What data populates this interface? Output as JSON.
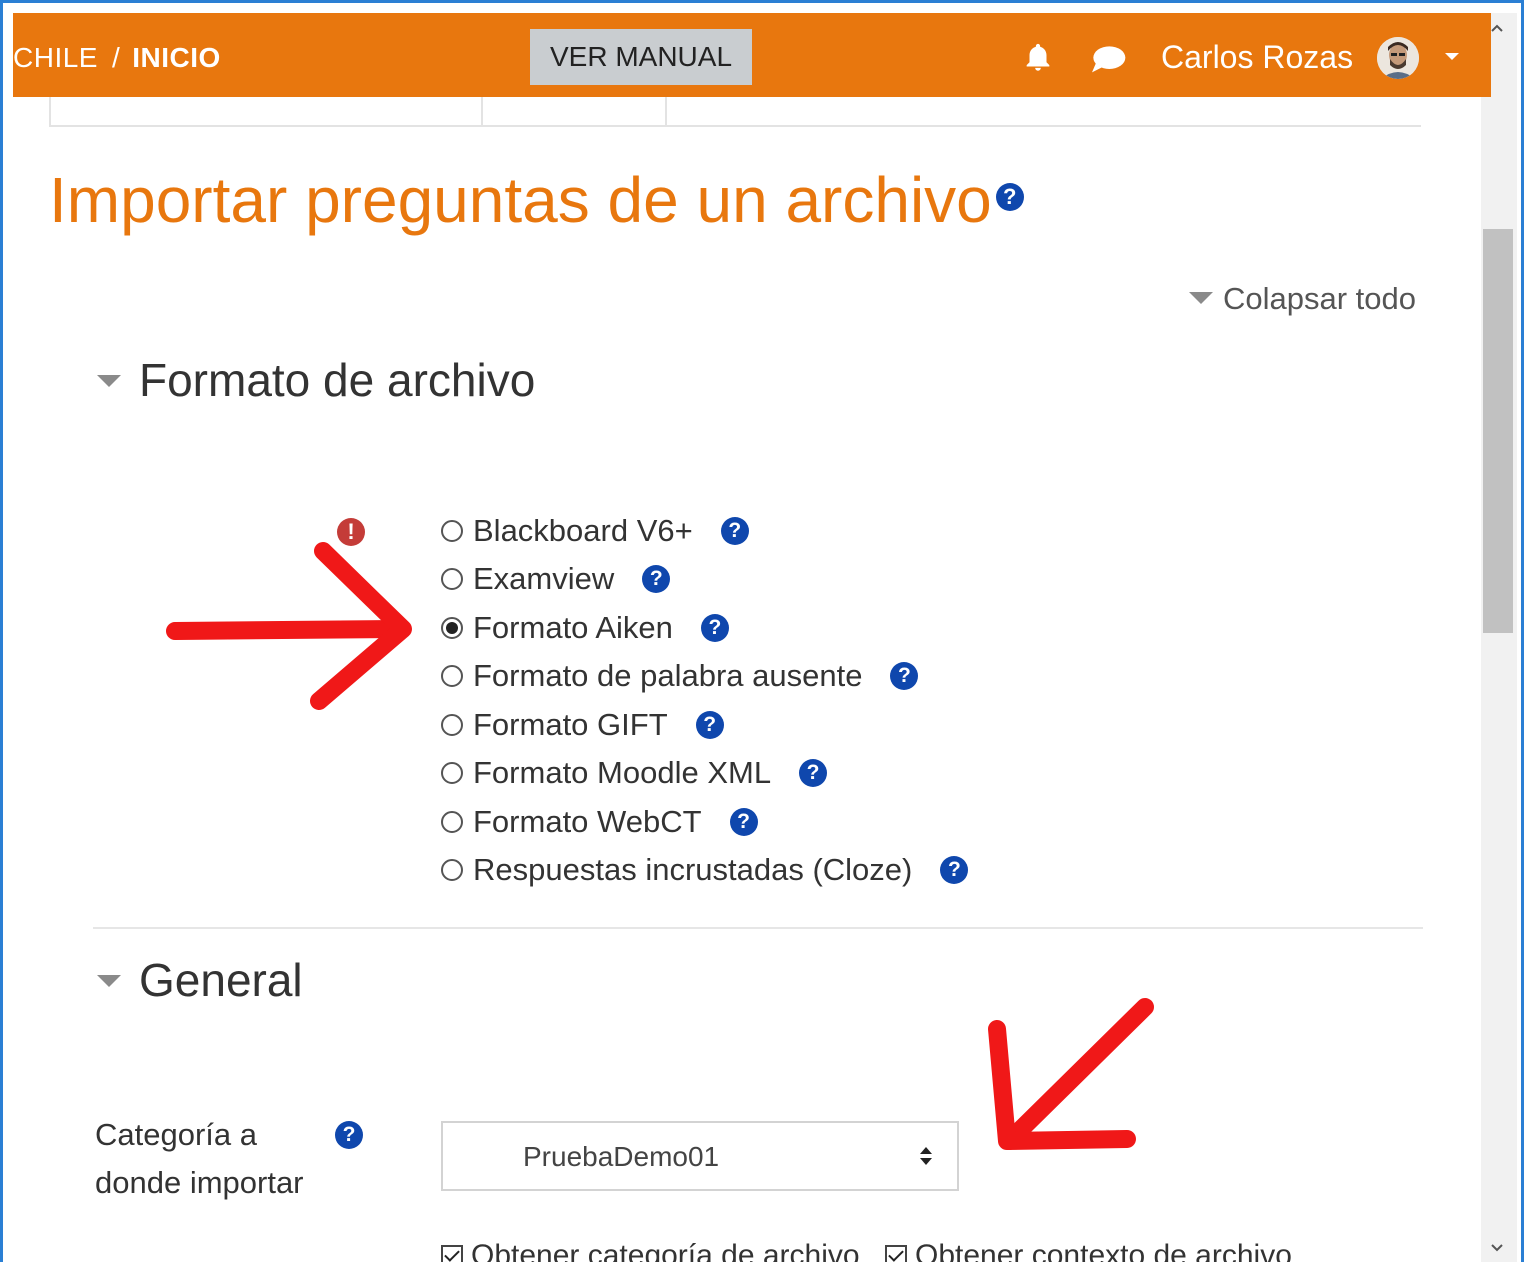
{
  "navbar": {
    "breadcrumb_site": "CHILE",
    "breadcrumb_sep": "/",
    "breadcrumb_home": "INICIO",
    "manual_button": "VER MANUAL",
    "notifications_icon": "bell-icon",
    "messages_icon": "chat-bubble-icon",
    "user_name": "Carlos Rozas",
    "menu_icon": "caret-down-icon"
  },
  "page": {
    "title": "Importar preguntas de un archivo",
    "title_help": "?",
    "collapse_all": "Colapsar todo"
  },
  "file_format": {
    "heading": "Formato de archivo",
    "required_icon": "!",
    "options": [
      {
        "label": "Blackboard V6+",
        "checked": false
      },
      {
        "label": "Examview",
        "checked": false
      },
      {
        "label": "Formato Aiken",
        "checked": true
      },
      {
        "label": "Formato de palabra ausente",
        "checked": false
      },
      {
        "label": "Formato GIFT",
        "checked": false
      },
      {
        "label": "Formato Moodle XML",
        "checked": false
      },
      {
        "label": "Formato WebCT",
        "checked": false
      },
      {
        "label": "Respuestas incrustadas (Cloze)",
        "checked": false
      }
    ],
    "help_symbol": "?"
  },
  "general": {
    "heading": "General",
    "category_label_line1": "Categoría a",
    "category_label_line2": "donde importar",
    "category_value": "PruebaDemo01",
    "checkbox_category": "Obtener categoría de archivo",
    "checkbox_context": "Obtener contexto de archivo"
  },
  "colors": {
    "brand_orange": "#e8770e",
    "help_blue": "#0f47ad",
    "alert_red": "#c43c38",
    "annotation_red": "#f01818"
  }
}
